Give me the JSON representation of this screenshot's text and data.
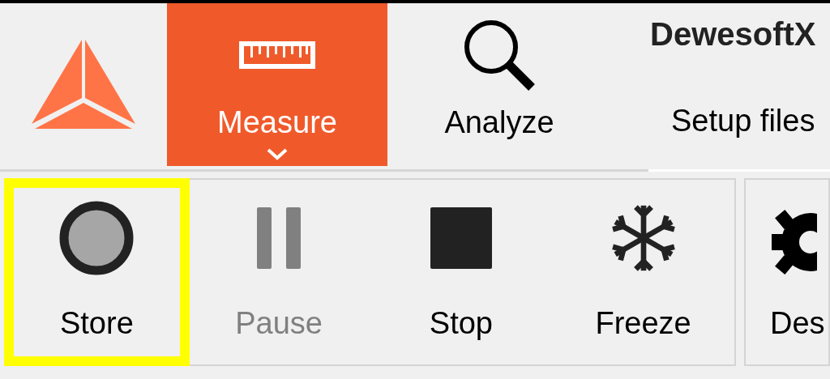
{
  "tabs": [
    {
      "label": "Measure",
      "selected": true,
      "kind": "measure",
      "dropdown": true
    },
    {
      "label": "Analyze",
      "selected": false,
      "kind": "analyze",
      "dropdown": false
    }
  ],
  "app_title": "DewesoftX",
  "setup_files": "Setup files",
  "toolbar": [
    {
      "label": "Store",
      "kind": "store",
      "disabled": false,
      "highlighted": true
    },
    {
      "label": "Pause",
      "kind": "pause",
      "disabled": true,
      "highlighted": false
    },
    {
      "label": "Stop",
      "kind": "stop",
      "disabled": false,
      "highlighted": false
    },
    {
      "label": "Freeze",
      "kind": "freeze",
      "disabled": false,
      "highlighted": false
    }
  ],
  "next_group": {
    "label": "Des",
    "kind": "gear"
  }
}
